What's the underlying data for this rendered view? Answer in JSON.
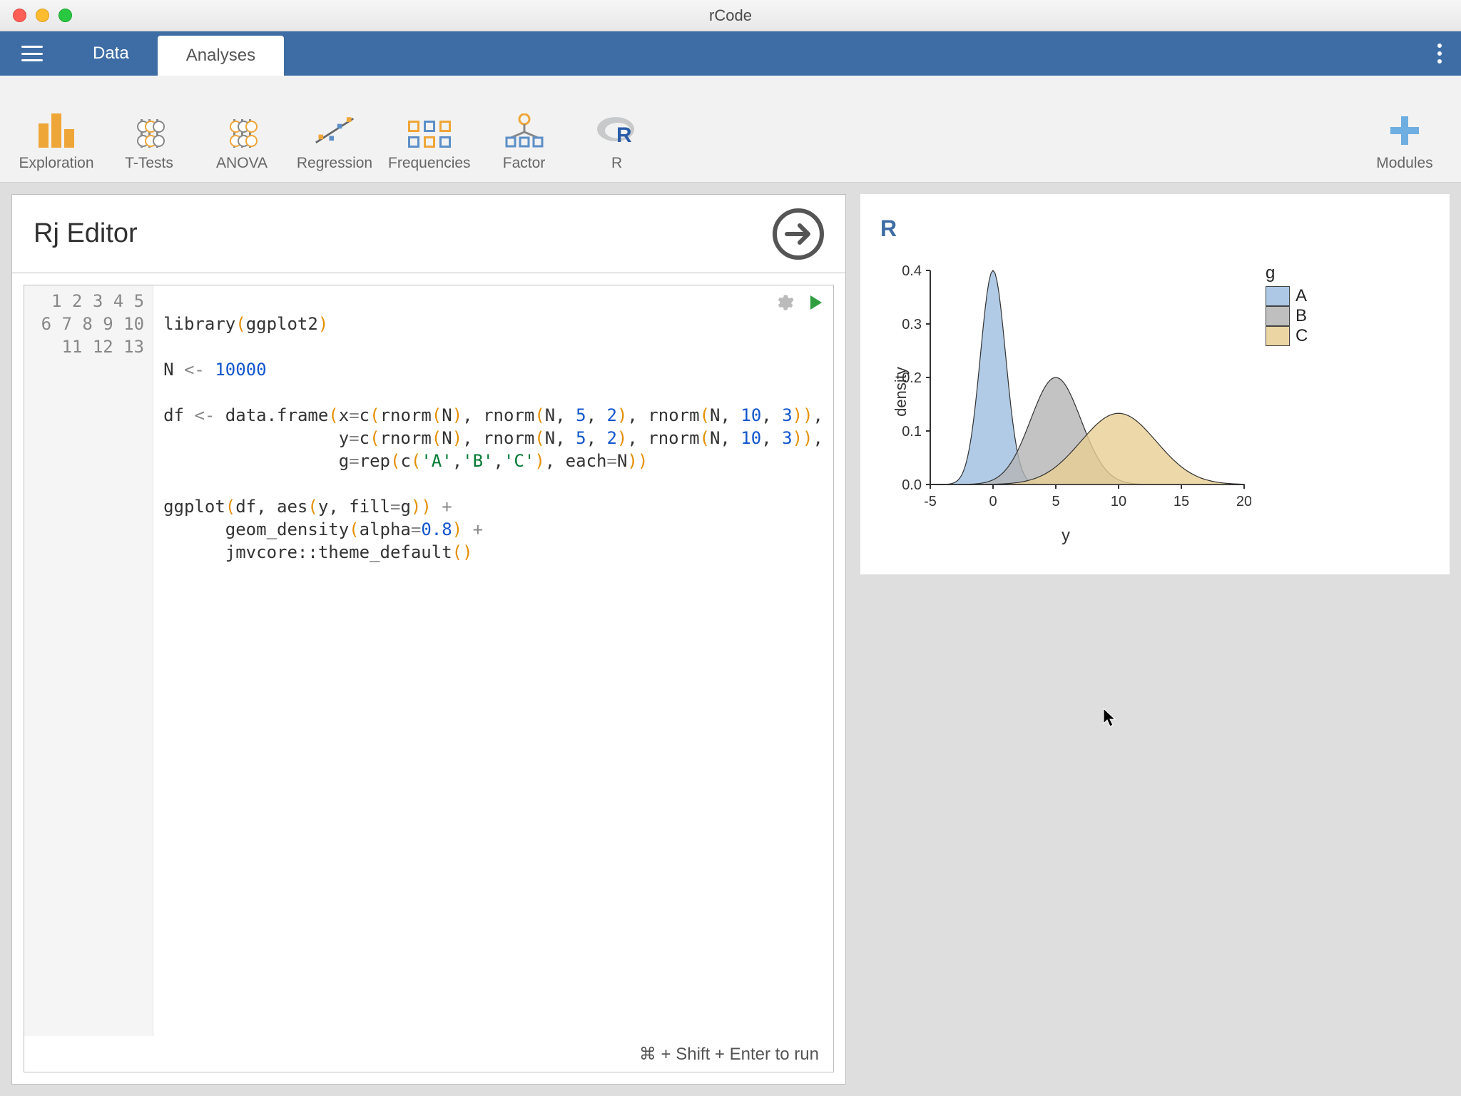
{
  "window": {
    "title": "rCode"
  },
  "topbar": {
    "tabs": [
      {
        "label": "Data",
        "active": false
      },
      {
        "label": "Analyses",
        "active": true
      }
    ]
  },
  "ribbon": {
    "items": [
      {
        "name": "exploration",
        "label": "Exploration"
      },
      {
        "name": "ttests",
        "label": "T-Tests"
      },
      {
        "name": "anova",
        "label": "ANOVA"
      },
      {
        "name": "regression",
        "label": "Regression"
      },
      {
        "name": "frequencies",
        "label": "Frequencies"
      },
      {
        "name": "factor",
        "label": "Factor"
      },
      {
        "name": "r",
        "label": "R"
      }
    ],
    "modules_label": "Modules"
  },
  "editor": {
    "panel_title": "Rj Editor",
    "hint": "⌘ + Shift + Enter to run",
    "line_numbers": [
      "1",
      "2",
      "3",
      "4",
      "5",
      "6",
      "7",
      "8",
      "9",
      "10",
      "11",
      "12",
      "13"
    ],
    "code_plain": "\nlibrary(ggplot2)\n\nN <- 10000\n\ndf <- data.frame(x=c(rnorm(N), rnorm(N, 5, 2), rnorm(N, 10, 3)),\n                 y=c(rnorm(N), rnorm(N, 5, 2), rnorm(N, 10, 3)),\n                 g=rep(c('A','B','C'), each=N))\n\nggplot(df, aes(y, fill=g)) +\n      geom_density(alpha=0.8) +\n      jmvcore::theme_default()\n"
  },
  "output": {
    "title": "R"
  },
  "chart_data": {
    "type": "area",
    "title": "",
    "xlabel": "y",
    "ylabel": "density",
    "xlim": [
      -5,
      20
    ],
    "ylim": [
      0,
      0.4
    ],
    "x_ticks": [
      -5,
      0,
      5,
      10,
      15,
      20
    ],
    "y_ticks": [
      0.0,
      0.1,
      0.2,
      0.3,
      0.4
    ],
    "legend": {
      "title": "g",
      "position": "right",
      "entries": [
        "A",
        "B",
        "C"
      ]
    },
    "colors": {
      "A": "#9ebee0",
      "B": "#b4b4b4",
      "C": "#e8ce93"
    },
    "series": [
      {
        "name": "A",
        "dist": "normal",
        "mean": 0,
        "sd": 1,
        "peak_density": 0.4
      },
      {
        "name": "B",
        "dist": "normal",
        "mean": 5,
        "sd": 2,
        "peak_density": 0.2
      },
      {
        "name": "C",
        "dist": "normal",
        "mean": 10,
        "sd": 3,
        "peak_density": 0.133
      }
    ]
  }
}
